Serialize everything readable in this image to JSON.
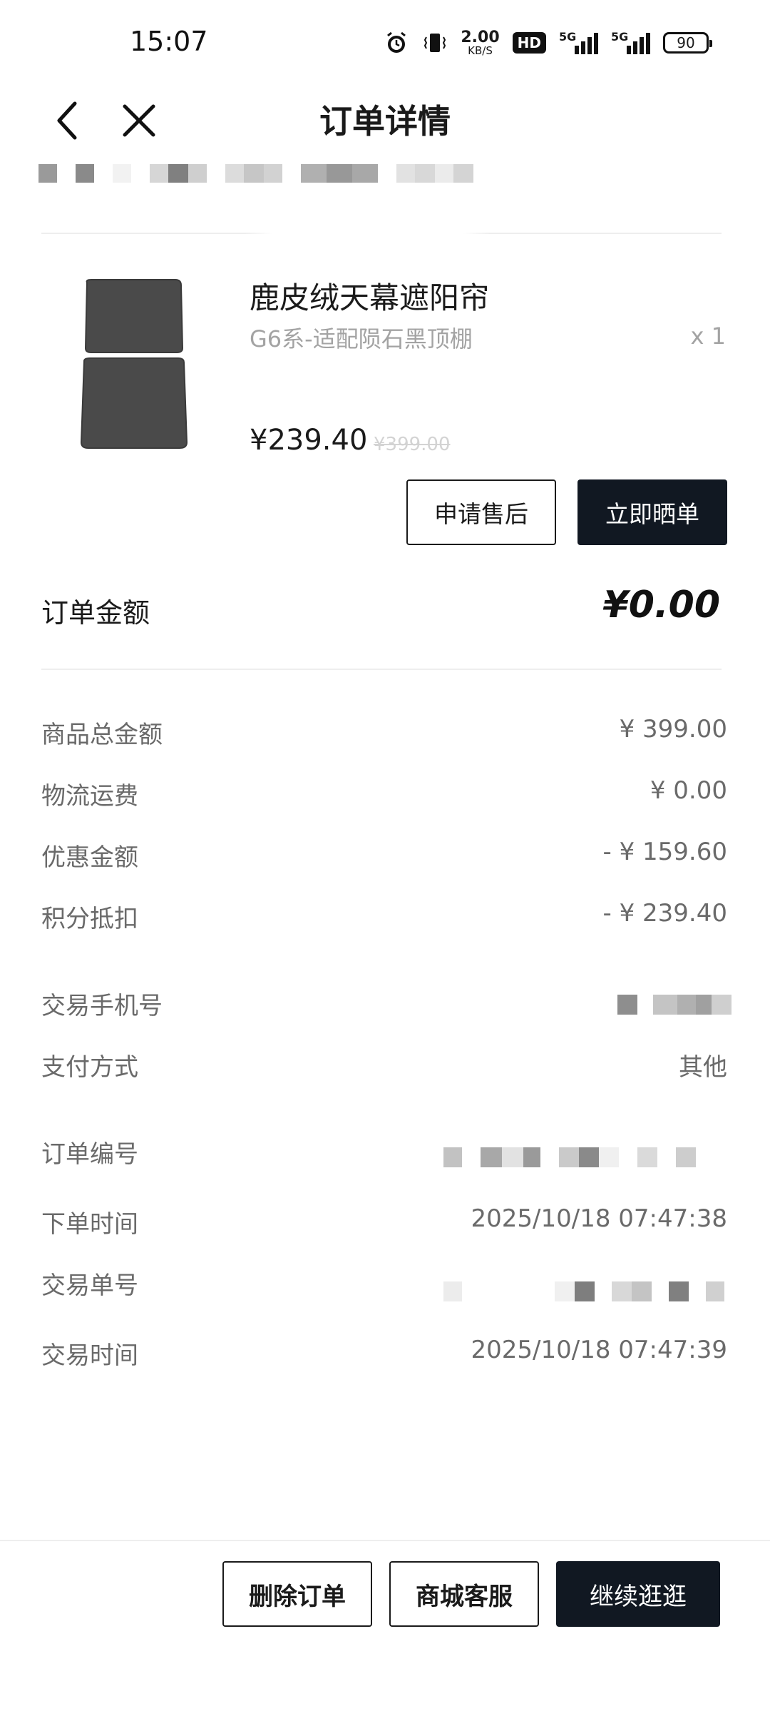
{
  "status_bar": {
    "time": "15:07",
    "net_speed_value": "2.00",
    "net_speed_unit": "KB/S",
    "hd_label": "HD",
    "signal1_label": "5G",
    "signal2_label": "5G",
    "battery": "90",
    "icons": [
      "alarm-icon",
      "vibrate-icon",
      "hd-icon",
      "signal-icon",
      "signal-icon",
      "battery-icon"
    ]
  },
  "nav": {
    "title": "订单详情",
    "back_icon": "chevron-left-icon",
    "close_icon": "close-icon"
  },
  "product": {
    "title": "鹿皮绒天幕遮阳帘",
    "spec": "G6系-适配陨石黑顶棚",
    "quantity": "x 1",
    "price": "¥239.40",
    "original_price": "¥399.00"
  },
  "product_actions": {
    "after_sales": "申请售后",
    "review": "立即晒单"
  },
  "order_amount": {
    "label": "订单金额",
    "value": "¥0.00"
  },
  "cost_details": [
    {
      "label": "商品总金额",
      "value": "¥ 399.00"
    },
    {
      "label": "物流运费",
      "value": "¥ 0.00"
    },
    {
      "label": "优惠金额",
      "value": "- ¥ 159.60"
    },
    {
      "label": "积分抵扣",
      "value": "- ¥ 239.40"
    }
  ],
  "payment": {
    "phone_label": "交易手机号",
    "method_label": "支付方式",
    "method_value": "其他"
  },
  "order_info": {
    "order_no_label": "订单编号",
    "order_time_label": "下单时间",
    "order_time_value": "2025/10/18 07:47:38",
    "trade_no_label": "交易单号",
    "trade_time_label": "交易时间",
    "trade_time_value": "2025/10/18 07:47:39"
  },
  "bottom_actions": {
    "delete": "删除订单",
    "service": "商城客服",
    "continue": "继续逛逛"
  },
  "colors": {
    "primary_dark": "#111822",
    "text_main": "#1a1a1a",
    "text_secondary": "#6a6a6a",
    "text_muted": "#a3a3a3"
  }
}
